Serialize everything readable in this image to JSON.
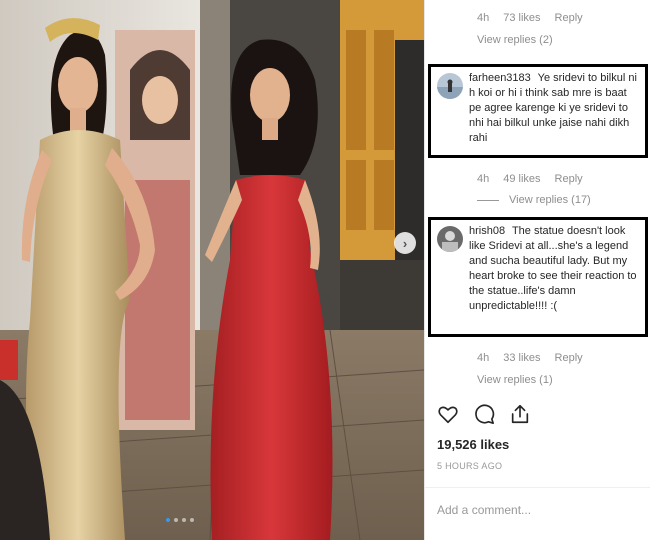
{
  "post_image": {
    "alt_semantic": "photo",
    "dots": [
      true,
      false,
      false,
      false
    ]
  },
  "comments": {
    "top_meta": {
      "time": "4h",
      "likes": "73 likes",
      "reply": "Reply"
    },
    "top_view_replies": "View replies (2)",
    "items": [
      {
        "username": "farheen3183",
        "text": "Ye sridevi to bilkul ni h koi or hi i think sab mre is baat pe agree karenge ki ye sridevi to nhi hai bilkul unke jaise nahi dikh rahi",
        "time": "4h",
        "likes": "49 likes",
        "reply": "Reply",
        "view_replies": "View replies (17)"
      },
      {
        "username": "hrish08",
        "text": "The statue doesn't look like Sridevi at all...she's a legend and sucha beautiful lady. But my heart broke to see their reaction to the statue..life's damn unpredictable!!!! :(",
        "time": "4h",
        "likes": "33 likes",
        "reply": "Reply",
        "view_replies": "View replies (1)"
      }
    ]
  },
  "actions": {
    "like_icon": "heart-icon",
    "comment_icon": "comment-icon",
    "share_icon": "share-icon"
  },
  "likes_count": "19,526 likes",
  "time_ago": "5 HOURS AGO",
  "add_comment": {
    "placeholder": "Add a comment..."
  },
  "colors": {
    "accent": "#3897f0",
    "muted": "#8e8e8e",
    "text": "#262626"
  }
}
